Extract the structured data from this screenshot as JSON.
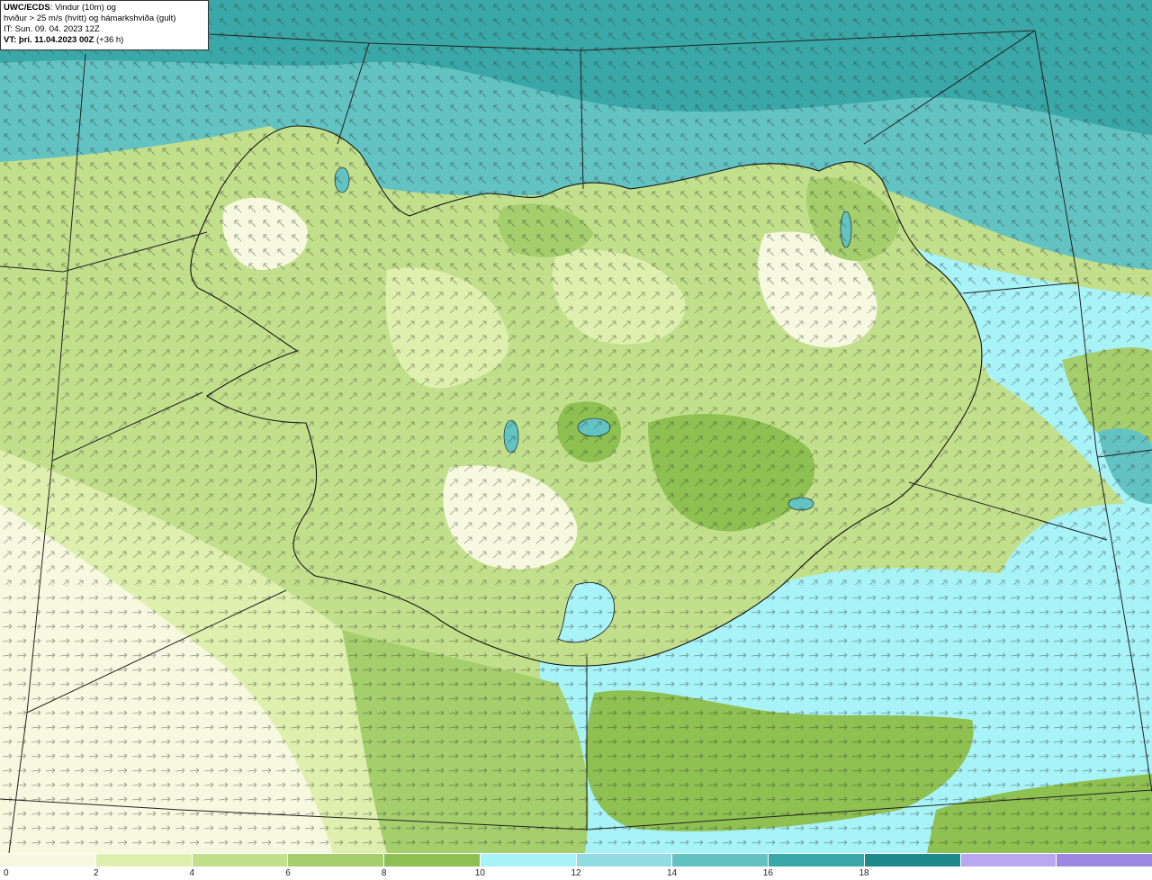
{
  "info": {
    "line1_bold": "UWC/ECDS",
    "line1_rest": ": Vindur (10m) og",
    "line2": "hviður > 25 m/s (hvítt) og hámarkshviða (gult)",
    "line3": "IT: Sun. 09. 04. 2023 12Z",
    "line4_bold": "VT: þri. 11.04.2023 00Z",
    "line4_rest": " (+36 h)"
  },
  "legend": {
    "colors": [
      "#f6f9df",
      "#deefae",
      "#c2e08c",
      "#a5cf6c",
      "#8ec052",
      "#a7f3f8",
      "#8fdde2",
      "#63c3c3",
      "#3aa8a8",
      "#1f8a8c",
      "#b9a8f0",
      "#9c88e2"
    ],
    "ticks": [
      "0",
      "2",
      "4",
      "6",
      "8",
      "10",
      "12",
      "14",
      "16",
      "18"
    ]
  },
  "map": {
    "ocean_north_color": "#3aa8a8",
    "ocean_south_color": "#a7f3f8",
    "land_base_color": "#c2e08c",
    "coastline_color": "#111111",
    "grid_color": "#222222",
    "arrow_color": "#222222"
  }
}
